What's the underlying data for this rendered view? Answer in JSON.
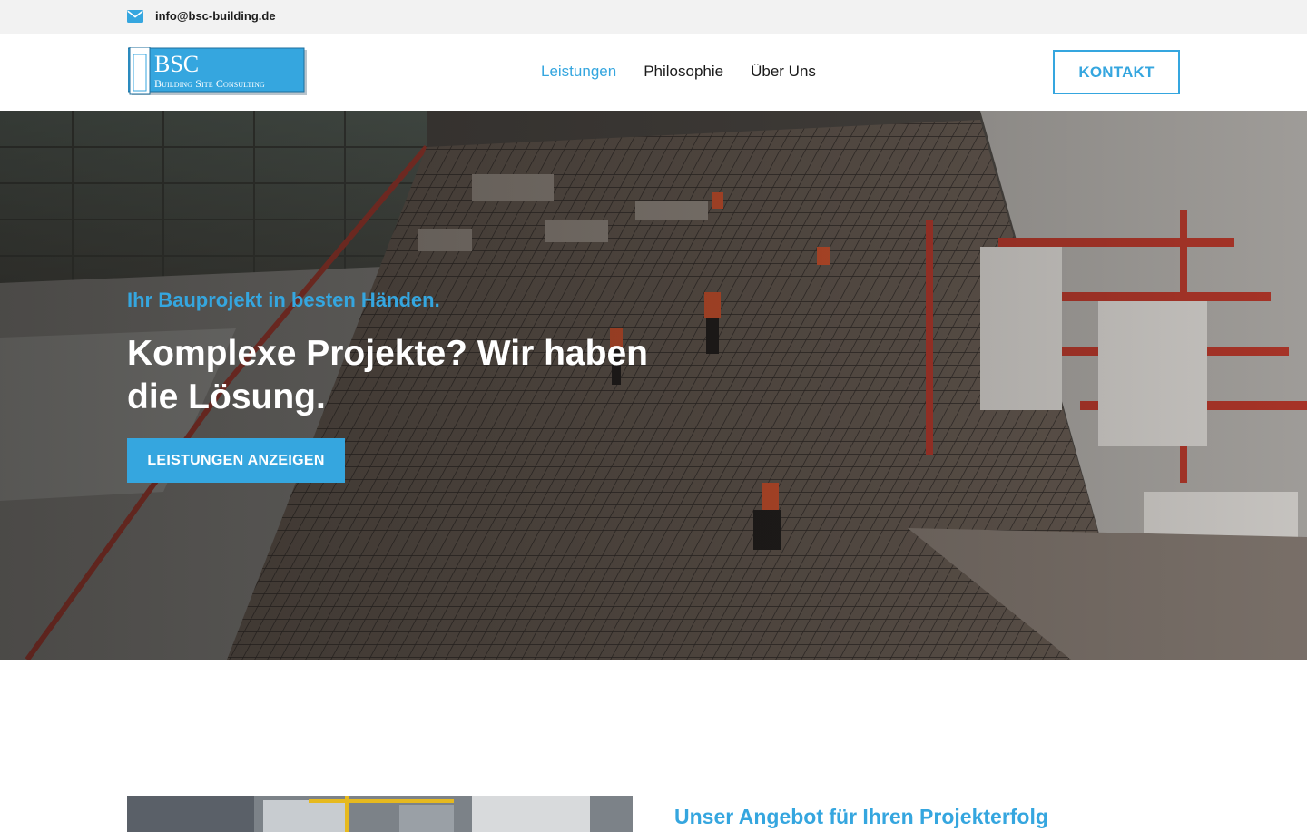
{
  "topbar": {
    "email": "info@bsc-building.de",
    "email_icon": "envelope-icon"
  },
  "header": {
    "logo": {
      "main": "BSC",
      "sub": "Building Site Consulting"
    },
    "nav": [
      {
        "label": "Leistungen",
        "active": true
      },
      {
        "label": "Philosophie",
        "active": false
      },
      {
        "label": "Über Uns",
        "active": false
      }
    ],
    "cta_label": "KONTAKT"
  },
  "hero": {
    "tagline": "Ihr Bauprojekt in besten Händen.",
    "title": "Komplexe Projekte? Wir haben die Lösung.",
    "button_label": "LEISTUNGEN ANZEIGEN"
  },
  "section": {
    "heading": "Unser Angebot für Ihren Projekterfolg"
  },
  "colors": {
    "accent": "#35a6df",
    "topbar_bg": "#f2f2f2",
    "text_dark": "#1a1a1a"
  }
}
